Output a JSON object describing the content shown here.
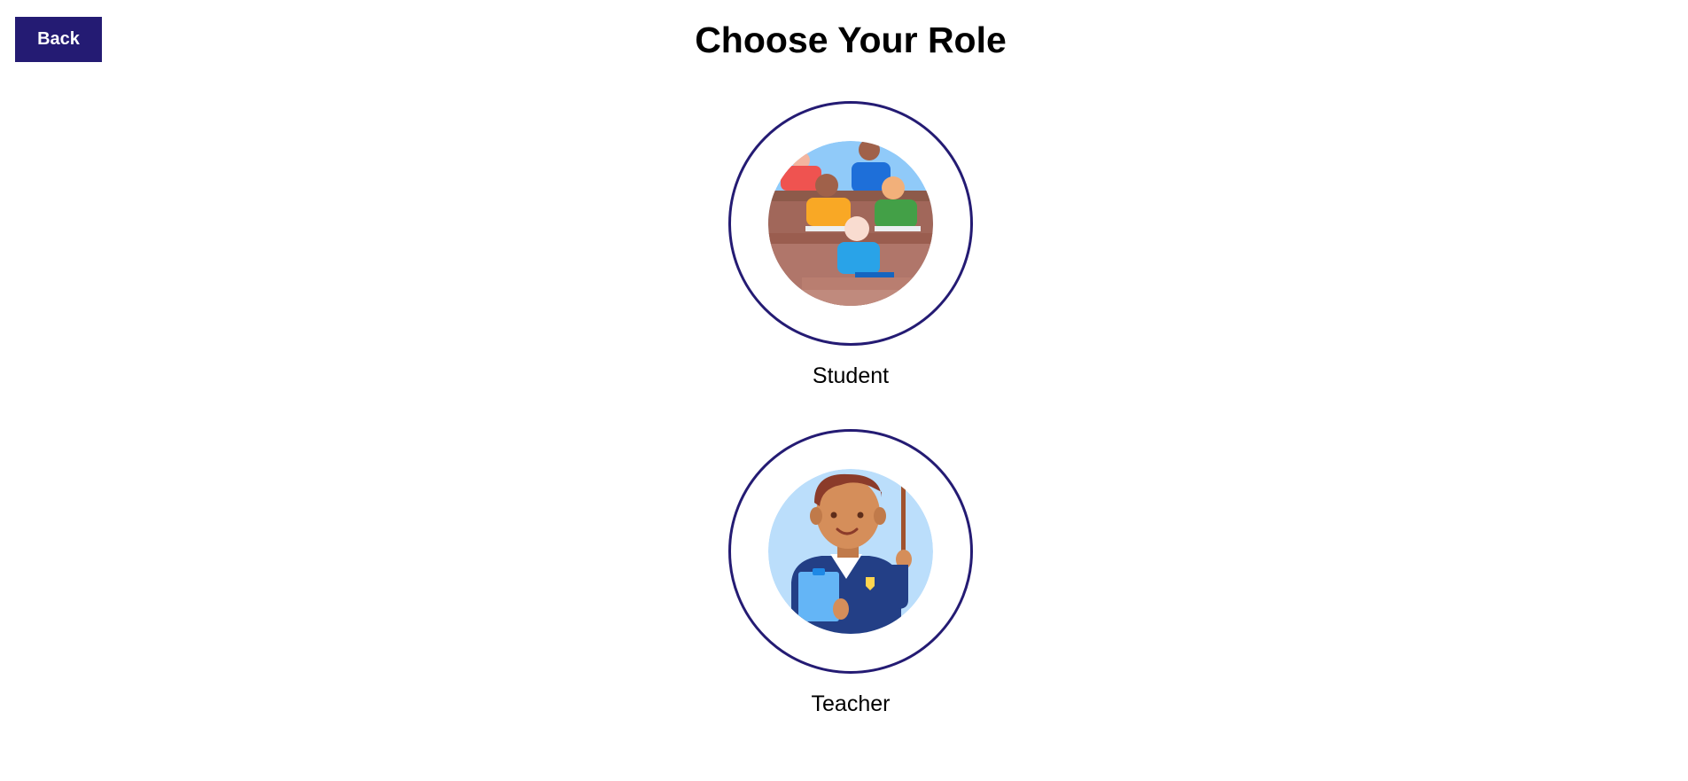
{
  "header": {
    "back_label": "Back",
    "title": "Choose Your Role"
  },
  "roles": [
    {
      "label": "Student",
      "icon": "classroom-students-icon"
    },
    {
      "label": "Teacher",
      "icon": "teacher-icon"
    }
  ],
  "colors": {
    "accent": "#241b73",
    "student_bg": "#90caf9",
    "teacher_bg": "#bbdefb"
  }
}
